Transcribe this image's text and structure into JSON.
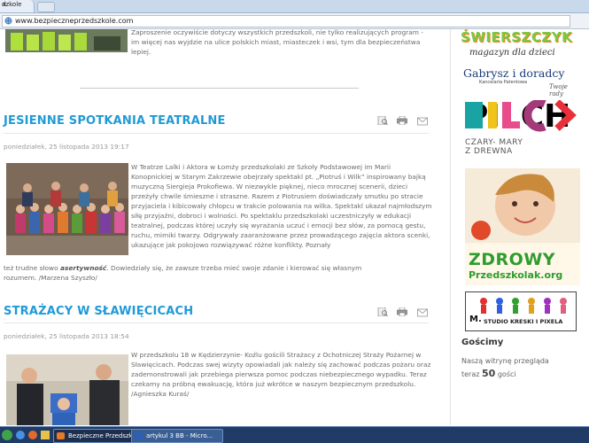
{
  "browser": {
    "tab_title": "dzkole",
    "close_glyph": "×",
    "url": "www.bezpieczneprzedszkole.com"
  },
  "intro": {
    "text": "Zaproszenie oczywiście dotyczy wszystkich przedszkoli, nie tylko realizujących program - im więcej nas wyjdzie na ulice polskich miast, miasteczek i wsi, tym dla bezpieczeństwa lepiej."
  },
  "articles": [
    {
      "title": "JESIENNE SPOTKANIA TEATRALNE",
      "date": "poniedziałek, 25 listopada 2013 19:17",
      "body": "W Teatrze Lalki i Aktora w Łomży przedszkolaki ze Szkoły Podstawowej im Marii Konopnickiej w Starym Zakrzewie obejrzały spektakl pt. „Piotruś i Wilk” inspirowany bajką muzyczną Siergieja Prokofiewa. W niezwykle pięknej, nieco mrocznej scenerii, dzieci przeżyły chwile śmieszne i straszne. Razem z Piotrusiem doświadczały smutku po stracie przyjaciela i kibicowały chłopcu w trakcie polowania na wilka. Spektakl ukazał najmłodszym siłę przyjaźni, dobroci i wolności. Po spektaklu przedszkolaki uczestniczyły w edukacji teatralnej, podczas której uczyły się wyrażania uczuć i emocji bez słów, za pomocą gestu, ruchu, mimiki twarzy. Odgrywały zaaranżowane przez prowadzącego zajęcia aktora scenki, ukazujące jak pokojowo rozwiązywać różne konflikty. Poznały",
      "tail_before": "też trudne słowo ",
      "tail_em": "asertywność",
      "tail_after": ". Dowiedziały się, że zawsze trzeba mieć swoje zdanie i kierować się własnym",
      "tail_last": "rozumem.   /Marzena Szyszło/"
    },
    {
      "title": "STRAŻACY W SŁAWIĘCICACH",
      "date": "poniedziałek, 25 listopada 2013 18:54",
      "body": "W przedszkolu 18 w Kędzierzynie- Koźlu gościli Strażacy z  Ochotniczej Straży Pożarnej w Sławięcicach. Podczas swej wizyty opowiadali jak należy się zachować podczas pożaru oraz zademonstrowali jak przebiega pierwsza pomoc podczas niebezpiecznego wypadku. Teraz czekamy na próbną ewakuację, która już wkrótce w naszym bezpiecznym przedszkolu. /Agnieszka Kuraś/"
    }
  ],
  "sidebar": {
    "swierszczyk": {
      "title": "ŚWIERSZCZYK",
      "subtitle": "magazyn dla dzieci"
    },
    "gabrysz": {
      "title": "Gabrysz i doradcy",
      "subtitle": "Kancelaria Patentowa",
      "script": "Twoje rady"
    },
    "pilch": {
      "title": "PILCH",
      "line1": "CZARY- MARY",
      "line2": "Z DREWNA"
    },
    "zdrowy": {
      "line1": "ZDROWY",
      "line2": "Przedszkolak.org"
    },
    "studio": {
      "text": "STUDIO KRESKI I PIXELA",
      "mark": "M."
    },
    "goscimy": {
      "heading": "Gościmy",
      "line1": "Naszą witrynę przegląda",
      "line2_prefix": "teraz ",
      "count": "50",
      "line2_suffix": " gości"
    }
  },
  "taskbar": {
    "items": [
      "Bezpieczne Przedszk...",
      "artykul 3 BB - Micro..."
    ]
  },
  "colors": {
    "heading_blue": "#1f9ad6",
    "zdrowy_green": "#2e9d2e",
    "taskbar": "#1f3b66"
  }
}
